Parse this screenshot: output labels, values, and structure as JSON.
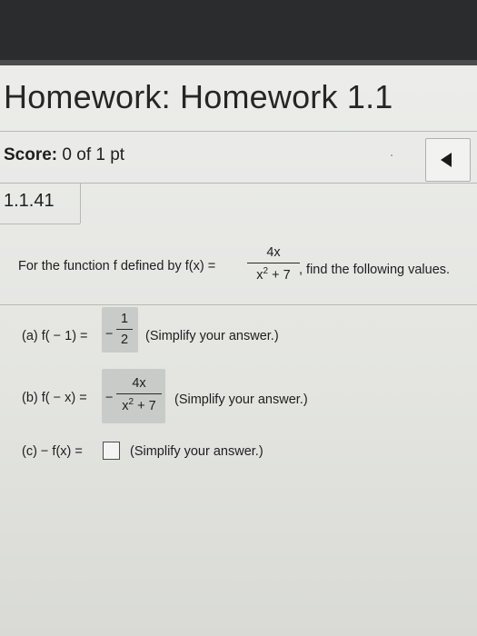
{
  "header": {
    "title": "Homework: Homework 1.1",
    "score_label": "Score:",
    "score_value": "0 of 1 pt",
    "question_number": "1.1.41",
    "nav_icon": "arrow-left-icon"
  },
  "problem": {
    "intro_text": "For the function f defined by f(x) =",
    "function_numerator": "4x",
    "function_denominator_base": "x",
    "function_denominator_exp": "2",
    "function_denominator_rest": " + 7",
    "intro_rest": ", find the following values.",
    "parts": [
      {
        "label": "(a)  f( − 1) =",
        "sign": "−",
        "answer_numerator": "1",
        "answer_denominator": "2",
        "hint": "(Simplify your answer.)"
      },
      {
        "label": "(b)  f( − x) =",
        "sign": "−",
        "answer_numerator": "4x",
        "answer_denominator_base": "x",
        "answer_denominator_exp": "2",
        "answer_denominator_rest": " + 7",
        "hint": "(Simplify your answer.)"
      },
      {
        "label": "(c)  − f(x) =",
        "answer": "",
        "hint": "(Simplify your answer.)"
      }
    ]
  }
}
